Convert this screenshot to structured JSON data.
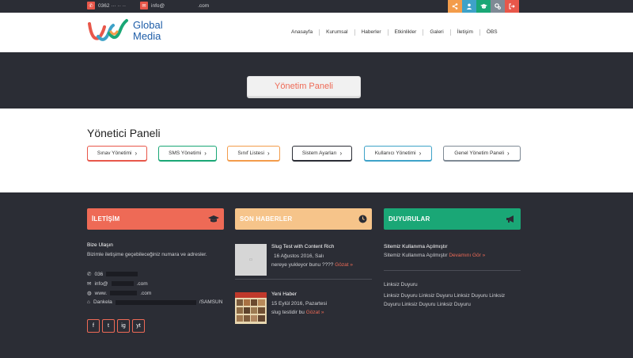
{
  "topbar": {
    "phone": "0362 ··· ·· ··",
    "email_prefix": "info@",
    "email_suffix": ".com",
    "social_colors": [
      "#f39c4b",
      "#3ea2c8",
      "#1aa776",
      "#7f8a95",
      "#e8574a"
    ]
  },
  "header": {
    "logo_line1": "Global",
    "logo_line2": "Media",
    "nav": [
      "Anasayfa",
      "Kurumsal",
      "Haberler",
      "Etkinlikler",
      "Galeri",
      "İletişim",
      "ÖBS"
    ]
  },
  "hero": {
    "button_label": "Yönetim Paneli"
  },
  "panel": {
    "title": "Yönetici Paneli",
    "buttons": [
      {
        "label": "Sınav Yönetimi",
        "color": "#e8574a"
      },
      {
        "label": "SMS Yönetimi",
        "color": "#1aa776"
      },
      {
        "label": "Sınıf Listesi",
        "color": "#f39c4b"
      },
      {
        "label": "Sistem Ayarları",
        "color": "#2b2d35"
      },
      {
        "label": "Kullanıcı Yönetimi",
        "color": "#3ea2c8"
      },
      {
        "label": "Genel Yönetim Paneli",
        "color": "#7f8a95"
      }
    ],
    "chevron": "›"
  },
  "footer": {
    "contact": {
      "heading": "İLETİŞİM",
      "color": "#ee6a56",
      "subtitle": "Bize Ulaşın",
      "desc": "Bizimle iletişime geçebileceğiniz numara ve adresler.",
      "phone": "036",
      "email_prefix": "info@",
      "email_suffix": ".com",
      "web_prefix": "www.",
      "web_suffix": ".com",
      "address_prefix": "Dankela",
      "address_suffix": "/SAMSUN"
    },
    "news": {
      "heading": "SON HABERLER",
      "color": "#f6c48a",
      "items": [
        {
          "title": "Slug Test with Content Rich",
          "date": "16 Ağustos 2016, Salı",
          "excerpt": "nereye yukleyor bunu ???? ",
          "more": "Gözat »"
        },
        {
          "title": "Yeni Haber",
          "date": "15 Eylül 2016, Pazartesi",
          "excerpt": "slug testidir bu ",
          "more": "Gözat »"
        }
      ]
    },
    "announcements": {
      "heading": "DUYURULAR",
      "color": "#1aa776",
      "items": [
        {
          "title": "Sitemiz Kullanıma Açılmıştır",
          "text": "Sitemiz Kullanıma Açılmıştır ",
          "more": "Devamını Gör »"
        },
        {
          "title": "Linksiz Duyuru",
          "text": "Linksiz Duyuru Linksiz Duyuru Linksiz Duyuru Linksiz Duyuru Linksiz Duyuru Linksiz Duyuru"
        }
      ]
    },
    "social_icons": [
      "f",
      "t",
      "ig",
      "yt"
    ]
  }
}
